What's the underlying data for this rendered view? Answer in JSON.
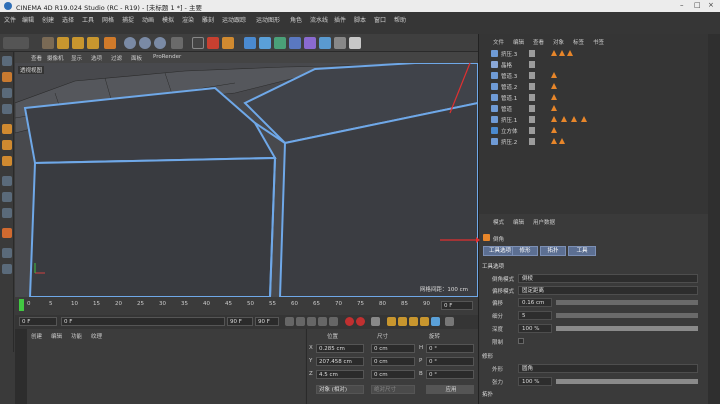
{
  "window": {
    "title": "CINEMA 4D R19.024 Studio (RC - R19) - [未标题 1 *] - 主要"
  },
  "menu": [
    "文件",
    "编辑",
    "创建",
    "选择",
    "工具",
    "网格",
    "捕捉",
    "动画",
    "模拟",
    "渲染",
    "雕刻",
    "运动跟踪",
    "运动图形",
    "角色",
    "流水线",
    "插件",
    "脚本",
    "窗口",
    "帮助"
  ],
  "viewport": {
    "menu": [
      "查看",
      "摄像机",
      "显示",
      "选项",
      "过滤",
      "面板",
      "ProRender"
    ],
    "label": "透视视图",
    "grid_text": "网格间距：100 cm"
  },
  "timeline": {
    "ticks": [
      "0",
      "5",
      "10",
      "15",
      "20",
      "25",
      "30",
      "35",
      "40",
      "45",
      "50",
      "55",
      "60",
      "65",
      "70",
      "75",
      "80",
      "85",
      "90"
    ],
    "end_field": "0 F",
    "start_field": "0 F",
    "current_field": "0 F",
    "max_field": "90 F",
    "max_field2": "90 F"
  },
  "materials": {
    "menu": [
      "创建",
      "编辑",
      "功能",
      "纹理"
    ]
  },
  "coords": {
    "headers": [
      "位置",
      "尺寸",
      "旋转"
    ],
    "rows": [
      {
        "axis": "X",
        "pos": "0.285 cm",
        "size": "0 cm",
        "rot_axis": "H",
        "rot": "0 °"
      },
      {
        "axis": "Y",
        "pos": "207.458 cm",
        "size": "0 cm",
        "rot_axis": "P",
        "rot": "0 °"
      },
      {
        "axis": "Z",
        "pos": "4.5 cm",
        "size": "0 cm",
        "rot_axis": "B",
        "rot": "0 °"
      }
    ],
    "mode": "对象 (相对)",
    "size_mode": "绝对尺寸",
    "apply": "应用"
  },
  "objects": {
    "tabs": [
      "文件",
      "编辑",
      "查看",
      "对象",
      "标签",
      "书签"
    ],
    "rows": [
      {
        "name": "挤压.3",
        "tris": 3
      },
      {
        "name": "晶格",
        "tris": 0
      },
      {
        "name": "管道.3",
        "tris": 1
      },
      {
        "name": "管道.2",
        "tris": 1
      },
      {
        "name": "管道.1",
        "tris": 1
      },
      {
        "name": "管道",
        "tris": 1
      },
      {
        "name": "挤压.1",
        "tris": 4
      },
      {
        "name": "立方体",
        "tris": 1
      },
      {
        "name": "挤压.2",
        "tris": 2
      }
    ]
  },
  "attributes": {
    "tabs": [
      "模式",
      "编辑",
      "用户数据"
    ],
    "object": "倒角",
    "subtabs": [
      "工具选项",
      "修形",
      "拓扑",
      "工具"
    ],
    "section": "工具选项",
    "fields": [
      {
        "label": "倒角模式",
        "value": "倒棱"
      },
      {
        "label": "偏移模式",
        "value": "固定距离"
      },
      {
        "label": "偏移",
        "value": "0.16 cm"
      },
      {
        "label": "细分",
        "value": "5"
      },
      {
        "label": "深度",
        "value": "100 %"
      },
      {
        "label": "限制",
        "value": ""
      }
    ],
    "section2": "修形",
    "fields2": [
      {
        "label": "外形",
        "value": "圆角"
      },
      {
        "label": "张力",
        "value": "100 %"
      }
    ],
    "section3": "拓扑"
  },
  "colors": {
    "accent": "#5b8fd6",
    "orange": "#e8862a",
    "edge": "#6fa8e8"
  }
}
